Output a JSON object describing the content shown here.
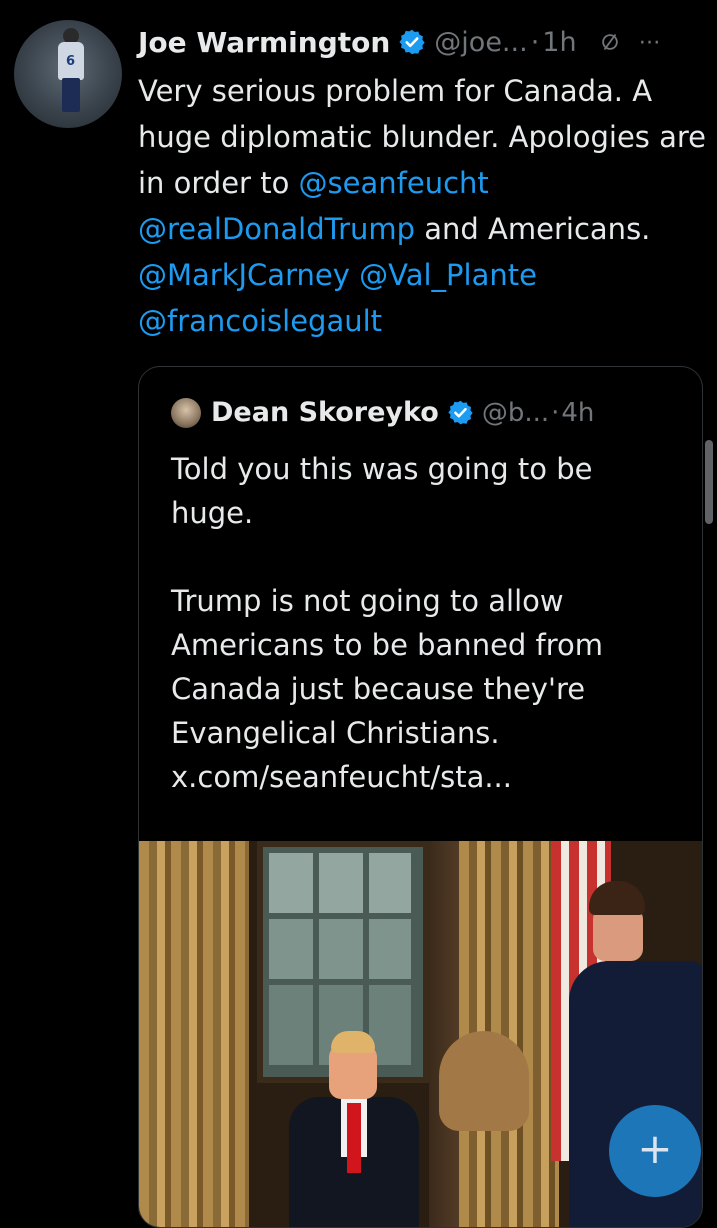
{
  "tweet": {
    "author_name": "Joe Warmington",
    "author_handle": "@joe...",
    "separator": "·",
    "time": "1h",
    "avatar_jersey_number": "6",
    "text_parts": [
      {
        "t": "Very serious problem for Canada. A huge diplomatic blunder. Apologies are in order to ",
        "kind": "text"
      },
      {
        "t": "@seanfeucht",
        "kind": "mention"
      },
      {
        "t": " ",
        "kind": "text"
      },
      {
        "t": "@realDonaldTrump",
        "kind": "mention"
      },
      {
        "t": " and Americans. ",
        "kind": "text"
      },
      {
        "t": "@MarkJCarney",
        "kind": "mention"
      },
      {
        "t": " ",
        "kind": "text"
      },
      {
        "t": "@Val_Plante",
        "kind": "mention"
      },
      {
        "t": " ",
        "kind": "text"
      },
      {
        "t": "@francoislegault",
        "kind": "mention"
      }
    ]
  },
  "quote": {
    "author_name": "Dean Skoreyko",
    "author_handle": "@b...",
    "separator": "·",
    "time": "4h",
    "text": "Told you this was going to be huge.\n\nTrump is not going to allow Americans to be banned from Canada just because they're Evangelical Christians. x.com/seanfeucht/sta..."
  },
  "fab": {
    "label": "+"
  },
  "icons": {
    "verified": "verified-badge-icon",
    "mute": "muted-icon",
    "more": "more-options-icon",
    "compose": "compose-plus-icon"
  },
  "colors": {
    "background": "#000000",
    "text": "#e7e9ea",
    "secondary_text": "#71767b",
    "link": "#1d9bf0",
    "verified": "#1d9bf0",
    "border": "#2f3336",
    "fab": "#1d7ec2"
  }
}
